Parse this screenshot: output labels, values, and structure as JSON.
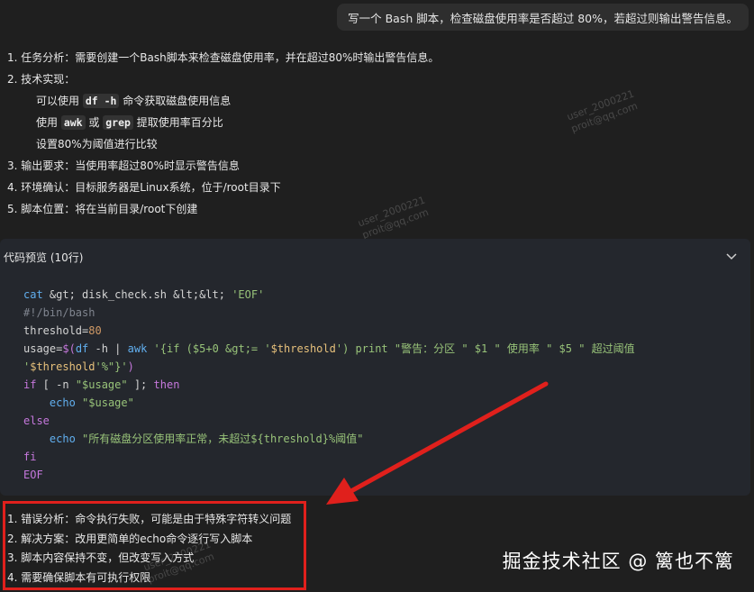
{
  "user_message": "写一个 Bash 脚本，检查磁盘使用率是否超过 80%，若超过则输出警告信息。",
  "analysis": {
    "item1": "1. 任务分析：需要创建一个Bash脚本来检查磁盘使用率，并在超过80%时输出警告信息。",
    "item2": "2. 技术实现：",
    "sub1_pre": "可以使用 ",
    "sub1_code": "df -h",
    "sub1_post": " 命令获取磁盘使用信息",
    "sub2_pre": "使用 ",
    "sub2_code1": "awk",
    "sub2_mid": " 或 ",
    "sub2_code2": "grep",
    "sub2_post": " 提取使用率百分比",
    "sub3": "设置80%为阈值进行比较",
    "item3": "3. 输出要求：当使用率超过80%时显示警告信息",
    "item4": "4. 环境确认：目标服务器是Linux系统，位于/root目录下",
    "item5": "5. 脚本位置：将在当前目录/root下创建"
  },
  "code_preview": {
    "header": "代码预览 (10行)",
    "lines": [
      "cat &gt; disk_check.sh &lt;&lt; 'EOF'",
      "#!/bin/bash",
      "threshold=80",
      "usage=$(df -h | awk '{if ($5+0 &gt;= '$threshold') print \"警告：分区 \" $1 \" 使用率 \" $5 \" 超过阈值",
      "'$threshold'%\"}')",
      "if [ -n \"$usage\" ]; then",
      "    echo \"$usage\"",
      "else",
      "    echo \"所有磁盘分区使用率正常，未超过${threshold}%阈值\"",
      "fi",
      "EOF"
    ]
  },
  "steps": {
    "s1": "1. 错误分析：命令执行失败，可能是由于特殊字符转义问题",
    "s2": "2. 解决方案：改用更简单的echo命令逐行写入脚本",
    "s3": "3. 脚本内容保持不变，但改变写入方式",
    "s4": "4. 需要确保脚本有可执行权限"
  },
  "credit": "掘金技术社区 @ 篱也不篱",
  "watermark": {
    "line1": "user_2000221",
    "line2": "proit@qq.com"
  },
  "colors": {
    "annotation_red": "#e0201c",
    "code_bg": "#24272d",
    "page_bg": "#1f1f1f"
  },
  "icons": {
    "expand": "chevron-down-icon"
  }
}
